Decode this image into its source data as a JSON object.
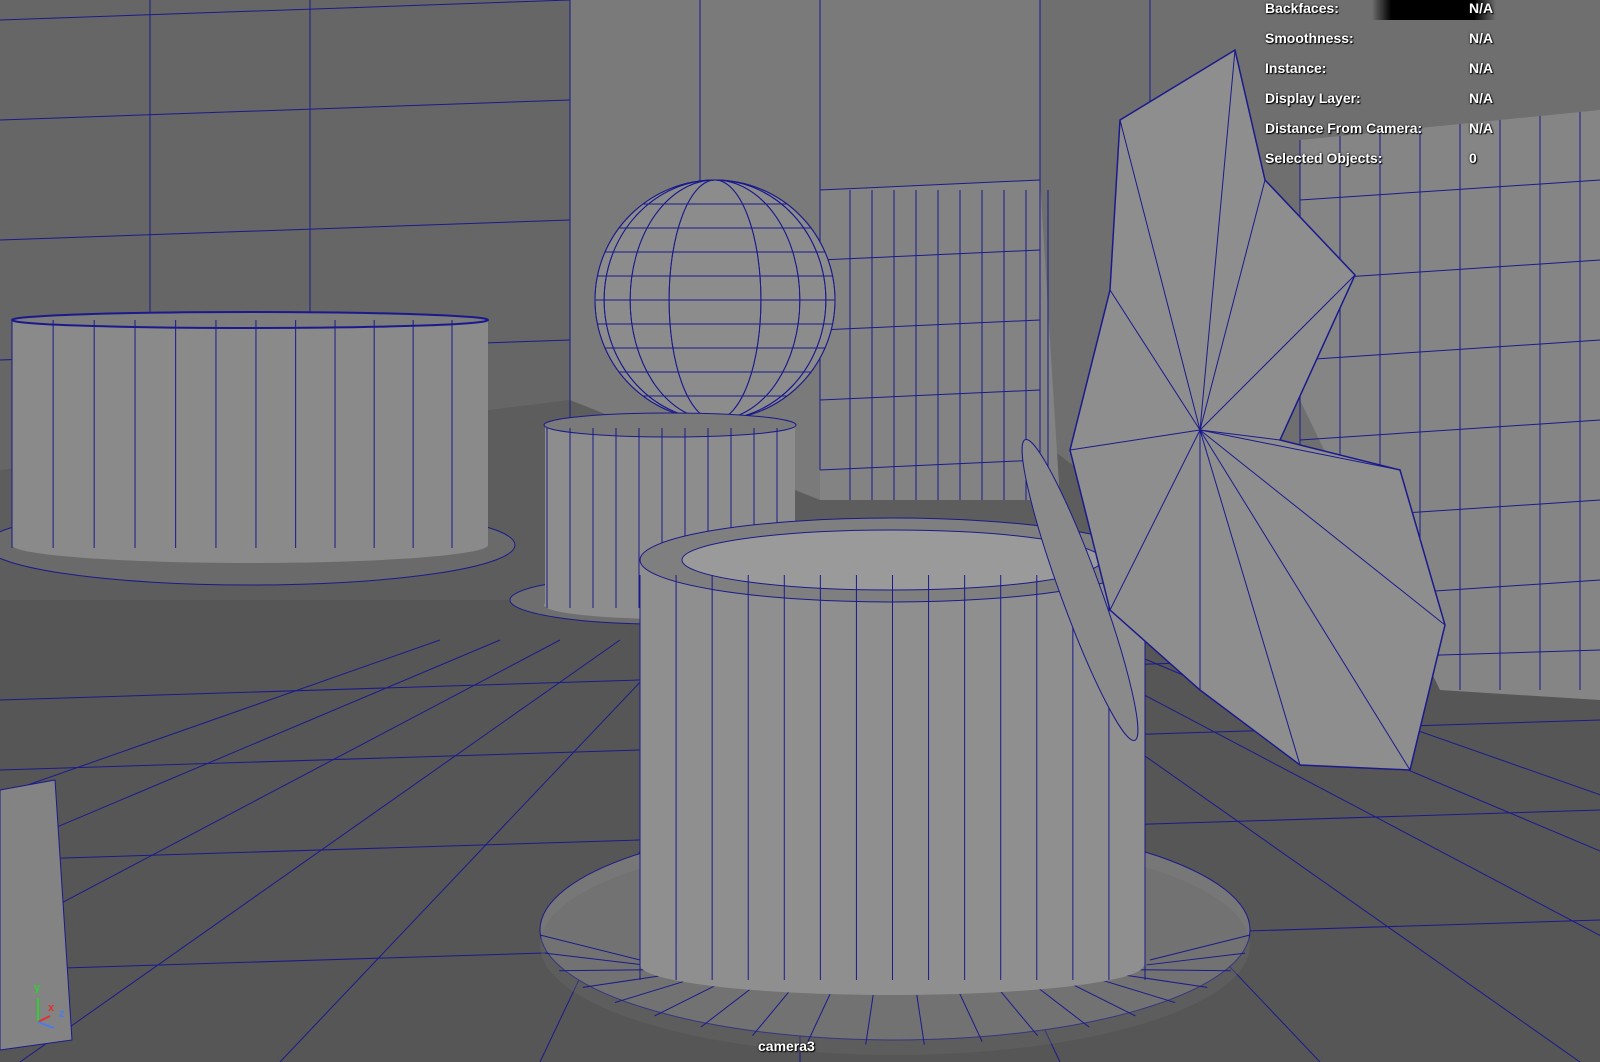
{
  "viewport": {
    "camera_name": "camera3",
    "background_color": "#5d5d5d",
    "wire_color": "#1a1a8c"
  },
  "hud": {
    "rows": [
      {
        "label": "Backfaces:",
        "value": "N/A"
      },
      {
        "label": "Smoothness:",
        "value": "N/A"
      },
      {
        "label": "Instance:",
        "value": "N/A"
      },
      {
        "label": "Display Layer:",
        "value": "N/A"
      },
      {
        "label": "Distance From Camera:",
        "value": "N/A"
      },
      {
        "label": "Selected Objects:",
        "value": "0"
      }
    ]
  },
  "axis_gizmo": {
    "x_label": "x",
    "y_label": "y",
    "z_label": "z",
    "x_color": "#e03030",
    "y_color": "#30d030",
    "z_color": "#4a7af0"
  }
}
